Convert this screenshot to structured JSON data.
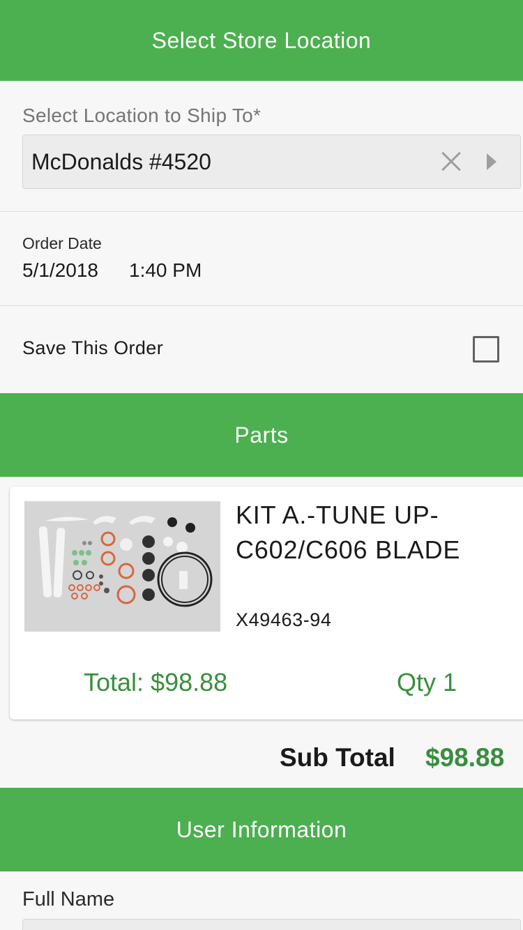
{
  "header": {
    "title": "Select Store Location"
  },
  "location": {
    "label": "Select Location to Ship To*",
    "value": "McDonalds #4520"
  },
  "order": {
    "date_label": "Order Date",
    "date": "5/1/2018",
    "time": "1:40 PM"
  },
  "save": {
    "label": "Save This Order",
    "checked": false
  },
  "parts": {
    "header": "Parts",
    "items": [
      {
        "name": "KIT A.-TUNE UP-C602/C606 BLADE",
        "sku": "X49463-94",
        "total": "Total: $98.88",
        "qty": "Qty 1"
      }
    ]
  },
  "subtotal": {
    "label": "Sub Total",
    "value": "$98.88"
  },
  "user": {
    "header": "User Information",
    "full_name_label": "Full Name",
    "full_name_value": ""
  },
  "colors": {
    "accent": "#4caf50",
    "price": "#388e3c"
  },
  "icons": {
    "clear": "close-icon",
    "next": "chevron-right-icon"
  }
}
